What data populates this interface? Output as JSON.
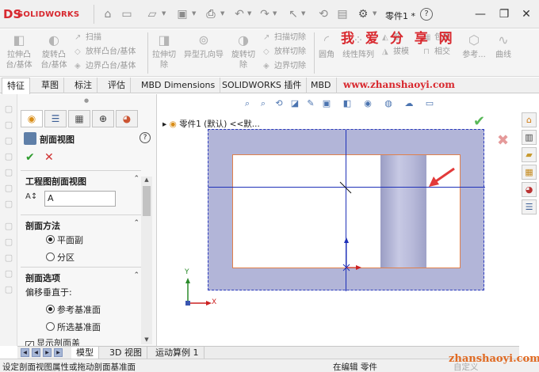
{
  "app": {
    "logo_mark": "DS",
    "logo_text": "SOLIDWORKS",
    "doc_title": "零件1 *",
    "help": "?"
  },
  "toolbar_icons": [
    "home-icon",
    "new-file-icon",
    "open-folder-icon",
    "save-icon",
    "print-icon",
    "undo-icon",
    "redo-icon",
    "select-arrow-icon",
    "rebuild-icon",
    "options-gear-icon"
  ],
  "window_buttons": {
    "minimize": "—",
    "restore": "❐",
    "close": "✕"
  },
  "commands": {
    "extrude_boss": "拉伸凸\n台/基体",
    "revolve_boss": "旋转凸\n台/基体",
    "sweep": "扫描",
    "loft_boss": "放样凸台/基体",
    "boundary_boss": "边界凸台/基体",
    "extrude_cut": "拉伸切\n除",
    "hole_wizard": "异型孔向导",
    "revolve_cut": "旋转切\n除",
    "swept_cut": "扫描切除",
    "lofted_cut": "放样切除",
    "boundary_cut": "边界切除",
    "fillet": "圆角",
    "linear_pattern": "线性阵列",
    "rib": "筋",
    "draft": "拔模",
    "wrap": "包覆",
    "intersect": "相交",
    "reference": "参考...",
    "curves": "曲线"
  },
  "watermark": {
    "title": "我 爱 分 享 网",
    "url": "www.zhanshaoyi.com",
    "bottom": "zhanshaoyi.com"
  },
  "tabs": [
    {
      "label": "特征"
    },
    {
      "label": "草图"
    },
    {
      "label": "标注"
    },
    {
      "label": "评估"
    },
    {
      "label": "MBD Dimensions"
    },
    {
      "label": "SOLIDWORKS 插件"
    },
    {
      "label": "MBD"
    }
  ],
  "panel": {
    "title": "剖面视图",
    "ok": "✔",
    "cancel": "✕",
    "section1": {
      "title": "工程图剖面视图",
      "name_value": "A"
    },
    "section2": {
      "title": "剖面方法",
      "options": [
        "平面副",
        "分区"
      ],
      "selected": 0
    },
    "section3": {
      "title": "剖面选项",
      "sub_label": "偏移垂直于:",
      "options": [
        "参考基准面",
        "所选基准面"
      ],
      "selected": 0,
      "checkbox_label": "显示剖面盖"
    }
  },
  "tree": {
    "item": "零件1 (默认) <<默..."
  },
  "triad": {
    "y": "Y",
    "x": "X"
  },
  "bottom_tabs": [
    {
      "label": "模型"
    },
    {
      "label": "3D 视图"
    },
    {
      "label": "运动算例 1"
    }
  ],
  "status": {
    "left": "设定剖面视图属性或拖动剖面基准面",
    "mid": "在编辑 零件",
    "right": "自定义"
  },
  "colors": {
    "brand": "#d7282f",
    "sheet": "#b2b5d8",
    "sketch_line": "#1f31b8",
    "part_edge": "#e0804b",
    "arrow": "#e23a3a"
  }
}
